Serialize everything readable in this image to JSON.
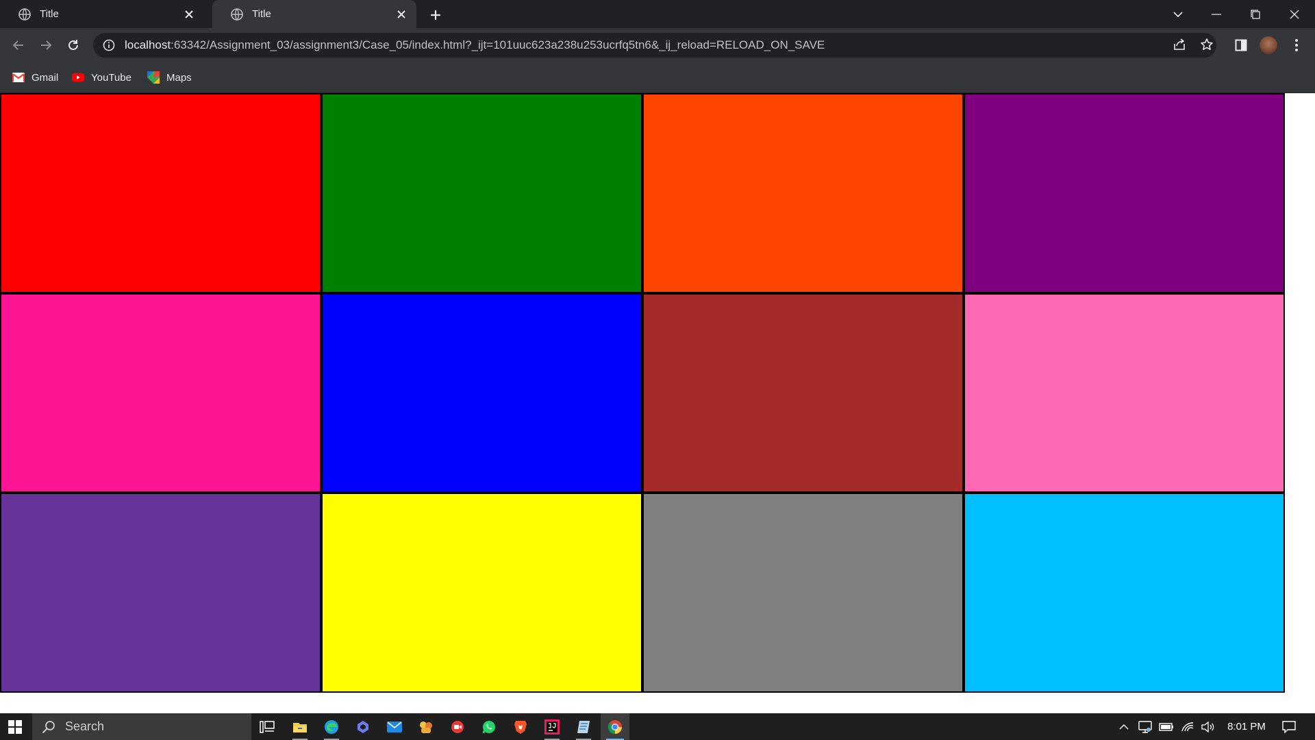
{
  "browser": {
    "tabs": [
      {
        "title": "Title",
        "active": false
      },
      {
        "title": "Title",
        "active": true
      }
    ],
    "address": {
      "host": "localhost",
      "rest": ":63342/Assignment_03/assignment3/Case_05/index.html?_ijt=101uuc623a238u253ucrfq5tn6&_ij_reload=RELOAD_ON_SAVE"
    },
    "bookmarks": [
      {
        "label": "Gmail",
        "icon": "gmail-icon"
      },
      {
        "label": "YouTube",
        "icon": "youtube-icon"
      },
      {
        "label": "Maps",
        "icon": "maps-icon"
      }
    ]
  },
  "page": {
    "border_color": "#000000",
    "cells": [
      {
        "color": "#ff0000"
      },
      {
        "color": "#008000"
      },
      {
        "color": "#ff4500"
      },
      {
        "color": "#800080"
      },
      {
        "color": "#ff1493"
      },
      {
        "color": "#0000ff"
      },
      {
        "color": "#a52a2a"
      },
      {
        "color": "#ff69b4"
      },
      {
        "color": "#663399"
      },
      {
        "color": "#ffff00"
      },
      {
        "color": "#808080"
      },
      {
        "color": "#00bfff"
      }
    ]
  },
  "taskbar": {
    "search_placeholder": "Search",
    "time": "8:01 PM",
    "apps": [
      "task-view-icon",
      "file-explorer-icon",
      "edge-icon",
      "copilot-icon",
      "mail-icon",
      "teams-icon",
      "screen-recorder-icon",
      "whatsapp-icon",
      "brave-icon",
      "intellij-icon",
      "notepad-icon",
      "chrome-icon"
    ]
  }
}
